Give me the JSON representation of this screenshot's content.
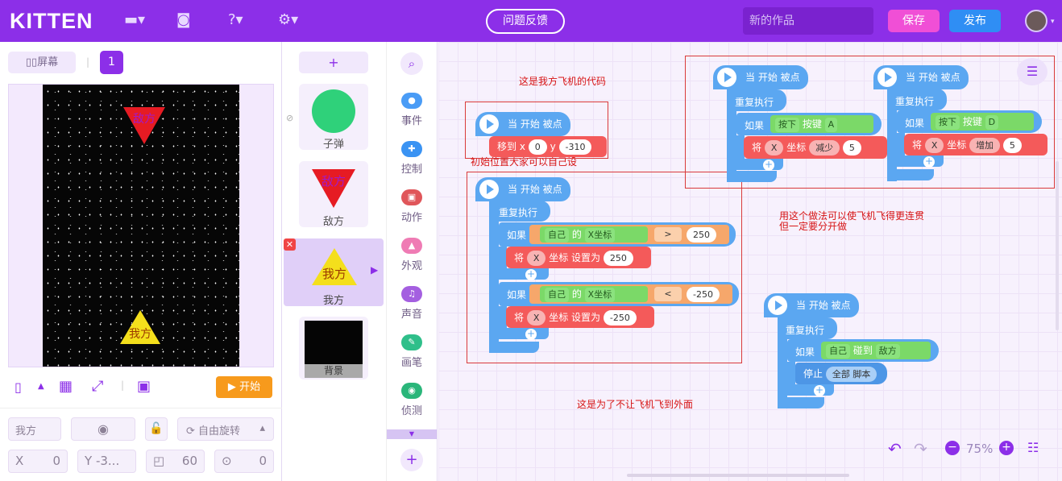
{
  "header": {
    "logo": "KITTEN",
    "feedback": "问题反馈",
    "title_placeholder": "新的作品",
    "save": "保存",
    "publish": "发布"
  },
  "stage": {
    "screen_btn": "屏幕",
    "scene_num": "1",
    "start_btn": "开始",
    "enemy_label": "敌方",
    "player_label": "我方"
  },
  "props": {
    "name": "我方",
    "rotate": "自由旋转",
    "x_label": "X",
    "x_val": "0",
    "y_label": "Y",
    "y_val": "-3...",
    "size_val": "60",
    "dir_val": "0"
  },
  "sprites": {
    "add": "+",
    "items": [
      {
        "label": "子弹"
      },
      {
        "label": "敌方"
      },
      {
        "label": "我方"
      },
      {
        "label": "背景"
      }
    ]
  },
  "categories": [
    {
      "label": "事件",
      "color": "#4a9cf6"
    },
    {
      "label": "控制",
      "color": "#3a93f3"
    },
    {
      "label": "动作",
      "color": "#e0565a"
    },
    {
      "label": "外观",
      "color": "#ef7bb4"
    },
    {
      "label": "声音",
      "color": "#a45fe0"
    },
    {
      "label": "画笔",
      "color": "#2fbf8a"
    },
    {
      "label": "侦测",
      "color": "#2ab67a"
    }
  ],
  "notes": {
    "n1": "这是我方飞机的代码",
    "n2": "初始位置大家可以自己设",
    "n3a": "用这个做法可以使飞机飞得更连贯",
    "n3b": "但一定要分开做",
    "n4": "这是为了不让飞机飞到外面"
  },
  "blocks": {
    "hat": "当 开始 被点击",
    "repeat": "重复执行",
    "if": "如果",
    "move": "移到 x",
    "x0": "0",
    "y": "y",
    "y0": "-310",
    "self": "自己",
    "of": "的",
    "xcoord": "X坐标",
    "gt": ">",
    "lt": "<",
    "v250": "250",
    "vm250": "-250",
    "set": "将",
    "X": "X",
    "coord_set": "坐标 设置为",
    "press": "按下",
    "key": "按键",
    "A": "A",
    "D": "D",
    "coord": "坐标",
    "dec": "减少",
    "inc": "增加",
    "five": "5",
    "touch": "碰到",
    "enemy": "敌方",
    "stop": "停止",
    "all_scripts": "全部 脚本"
  },
  "zoom": "75%"
}
